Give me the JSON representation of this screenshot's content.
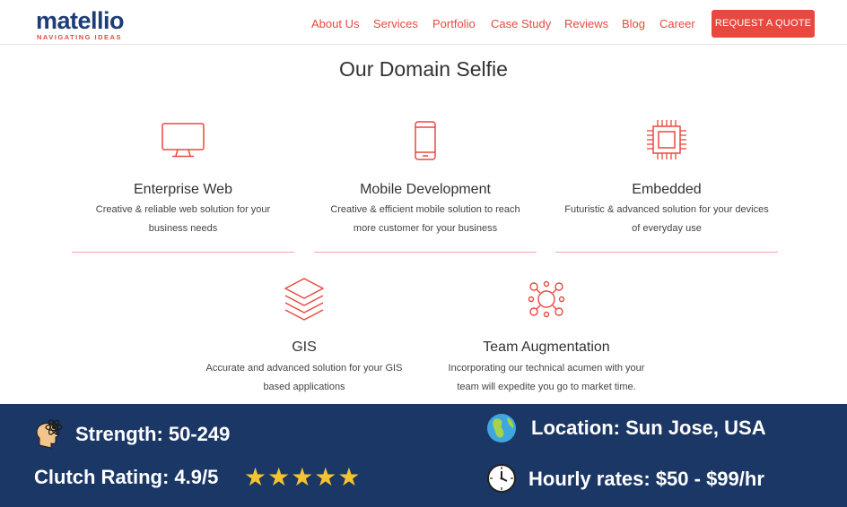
{
  "brand": {
    "name": "matellio",
    "tagline": "NAVIGATING IDEAS",
    "color": "#1d3c78",
    "accent": "#e8493f"
  },
  "nav": {
    "items": [
      {
        "label": "About Us"
      },
      {
        "label": "Services"
      },
      {
        "label": "Portfolio"
      },
      {
        "label": "Case Study"
      },
      {
        "label": "Reviews"
      },
      {
        "label": "Blog"
      },
      {
        "label": "Career"
      }
    ],
    "cta": "REQUEST A QUOTE"
  },
  "section": {
    "title": "Our Domain Selfie"
  },
  "domains": [
    {
      "title": "Enterprise Web",
      "desc1": "Creative & reliable web solution for your",
      "desc2": "business needs",
      "icon": "monitor-icon"
    },
    {
      "title": "Mobile Development",
      "desc1": "Creative & efficient mobile solution to reach",
      "desc2": "more customer for your business",
      "icon": "smartphone-icon"
    },
    {
      "title": "Embedded",
      "desc1": "Futuristic & advanced solution for your devices",
      "desc2": "of everyday use",
      "icon": "chip-icon"
    },
    {
      "title": "GIS",
      "desc1": "Accurate and advanced solution for your GIS",
      "desc2": "based applications",
      "icon": "layers-icon"
    },
    {
      "title": "Team Augmentation",
      "desc1": "Incorporating our technical acumen with your",
      "desc2": "team will expedite you go to market time.",
      "icon": "team-icon"
    }
  ],
  "stats": {
    "strength": "Strength: 50-249",
    "clutch": "Clutch Rating: 4.9/5",
    "stars": "★★★★★",
    "rating_value": 5,
    "location": "Location: Sun Jose, USA",
    "rates": "Hourly rates: $50 - $99/hr",
    "banner_color": "#1b3765",
    "star_color": "#f4c430"
  }
}
